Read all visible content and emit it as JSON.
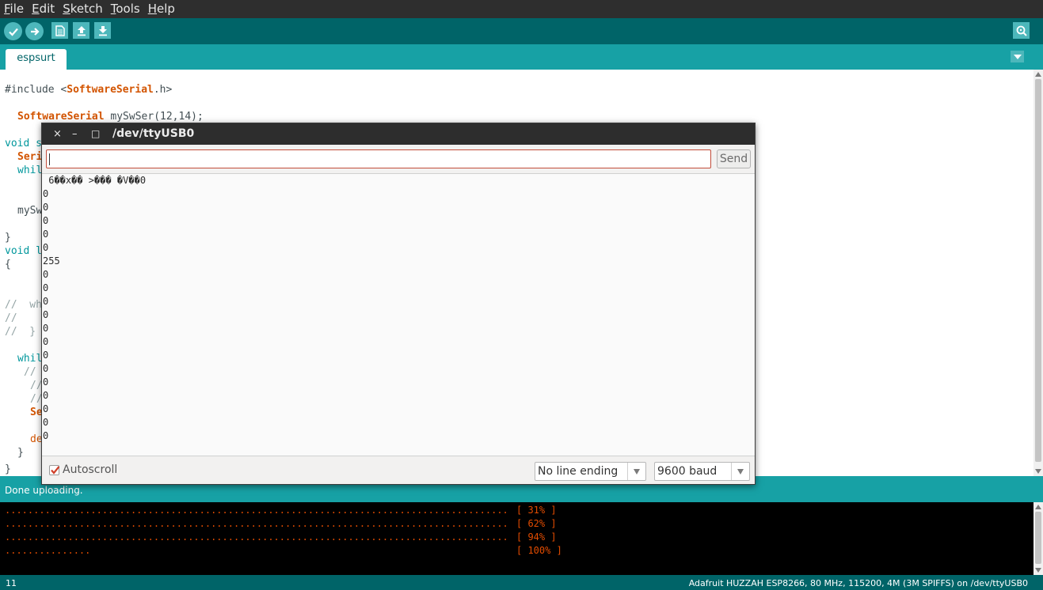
{
  "menubar": {
    "items": [
      {
        "label": "File",
        "ul": "F",
        "rest": "ile"
      },
      {
        "label": "Edit",
        "ul": "E",
        "rest": "dit"
      },
      {
        "label": "Sketch",
        "ul": "S",
        "rest": "ketch"
      },
      {
        "label": "Tools",
        "ul": "T",
        "rest": "ools"
      },
      {
        "label": "Help",
        "ul": "H",
        "rest": "elp"
      }
    ]
  },
  "toolbar": {
    "buttons": [
      "verify-icon",
      "upload-icon",
      "new-icon",
      "open-icon",
      "save-icon"
    ],
    "right": "serial-monitor-icon"
  },
  "tabs": {
    "active": "espsurt"
  },
  "editor": {
    "line1_hash": "#include <",
    "line1_lib": "SoftwareSerial",
    "line1_tail": ".h>",
    "line2_type": "SoftwareSerial",
    "line2_tail": " mySwSer(12,14);",
    "line3": "void s",
    "line4_kw": "Seri",
    "line5": "whil",
    "line6": "mySw",
    "line7": "}",
    "line8": "void l",
    "line9": "{",
    "line10": "//  wh",
    "line11": "//",
    "line12": "//  }",
    "line13": "whil",
    "line14": "//",
    "line15": "//",
    "line16": "//",
    "line17_kw": "Se",
    "line18": "de",
    "line19": "}",
    "line20": "}"
  },
  "status": {
    "message": "Done uploading."
  },
  "console": {
    "lines": [
      {
        "dots": "........................................................................................",
        "pct": "[ 31% ]"
      },
      {
        "dots": "........................................................................................",
        "pct": "[ 62% ]"
      },
      {
        "dots": "........................................................................................",
        "pct": "[ 94% ]"
      },
      {
        "dots": "...............",
        "pct": "[ 100% ]"
      }
    ]
  },
  "footer": {
    "line_number": "11",
    "board": "Adafruit HUZZAH ESP8266, 80 MHz, 115200, 4M (3M SPIFFS) on /dev/ttyUSB0"
  },
  "serial_monitor": {
    "title": "/dev/ttyUSB0",
    "close": "×",
    "minimize": "–",
    "maximize": "□",
    "input_value": "",
    "send_label": "Send",
    "output_lines": [
      " 6��x�� >��� �V��0",
      "0",
      "0",
      "0",
      "0",
      "0",
      "255",
      "0",
      "0",
      "0",
      "0",
      "0",
      "0",
      "0",
      "0",
      "0",
      "0",
      "0",
      "0",
      "0"
    ],
    "autoscroll_label": "Autoscroll",
    "autoscroll_checked": true,
    "line_ending": "No line ending",
    "baud": "9600 baud"
  },
  "colors": {
    "teal_dark": "#006468",
    "teal": "#17a1a5",
    "accent_orange": "#e34c00"
  }
}
